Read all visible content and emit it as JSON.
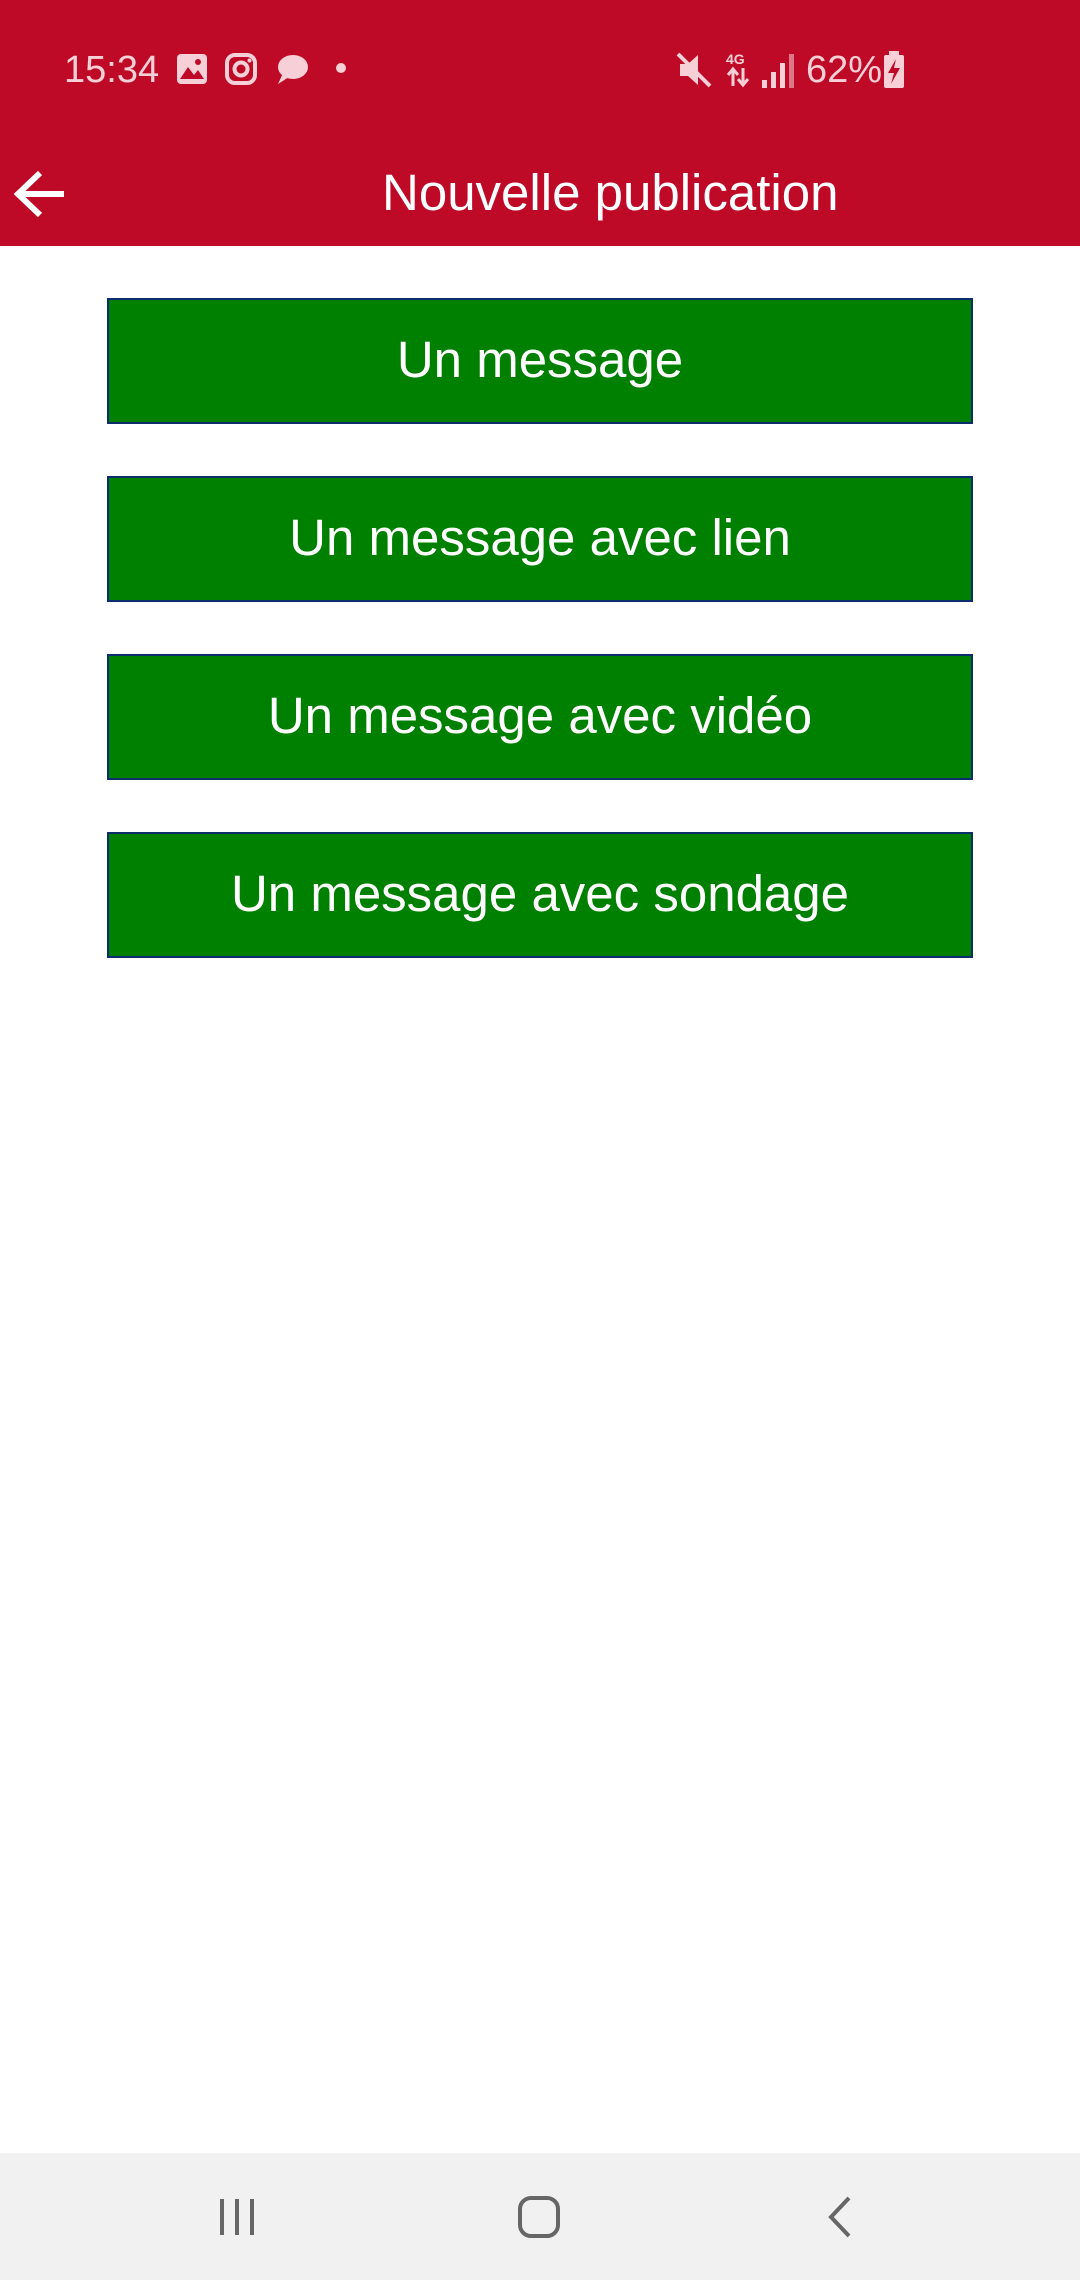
{
  "status_bar": {
    "time": "15:34",
    "battery_percent": "62%",
    "network": "4G",
    "icons": [
      "gallery-icon",
      "instagram-icon",
      "chat-bubble-icon",
      "dot-icon",
      "mute-icon",
      "network-4g-icon",
      "signal-icon",
      "battery-charging-icon"
    ]
  },
  "app_bar": {
    "title": "Nouvelle publication",
    "back_icon": "arrow-left-icon"
  },
  "options": [
    {
      "label": "Un message"
    },
    {
      "label": "Un message avec lien"
    },
    {
      "label": "Un message avec vidéo"
    },
    {
      "label": "Un message avec sondage"
    }
  ],
  "nav_bar": {
    "icons": [
      "recent-apps-icon",
      "home-icon",
      "back-icon"
    ]
  },
  "colors": {
    "header": "#bf0a27",
    "button": "#008000",
    "button_border": "#0b2d6b",
    "nav_bar": "#f1f1f1"
  }
}
